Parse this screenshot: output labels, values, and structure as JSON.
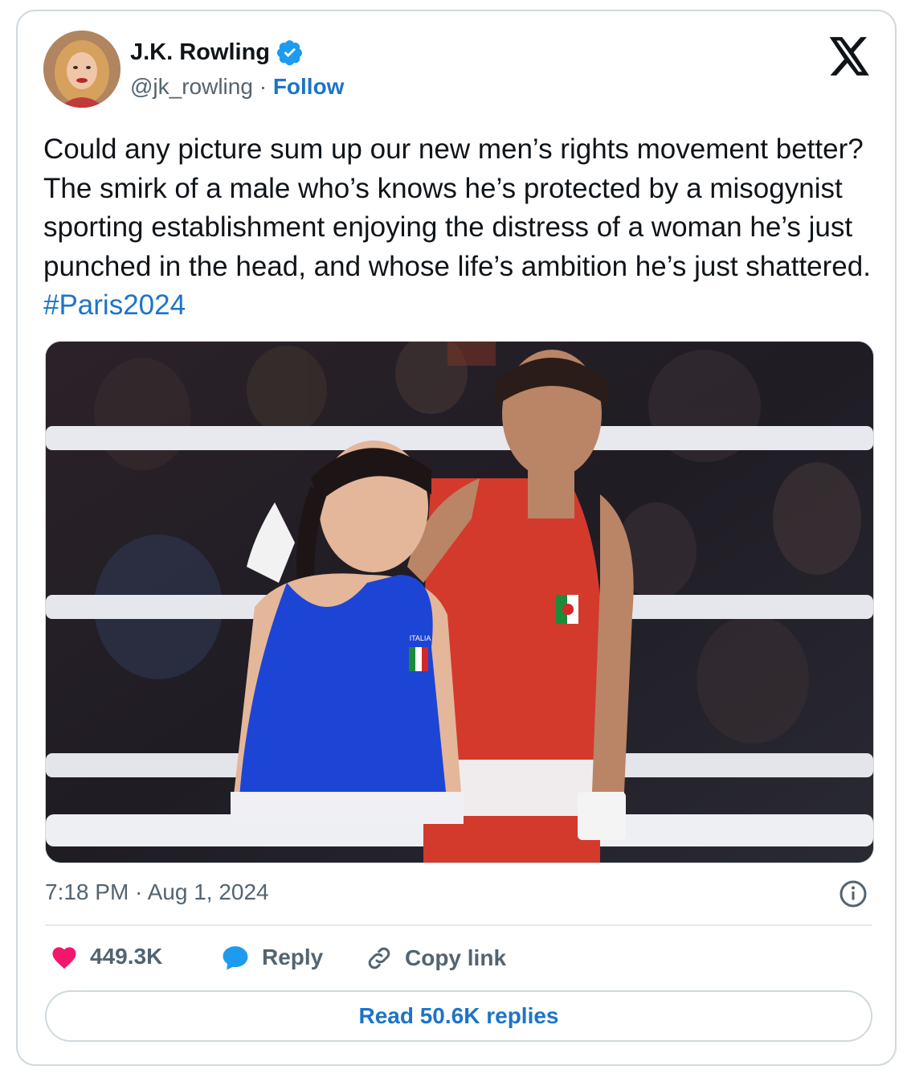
{
  "author": {
    "name": "J.K. Rowling",
    "handle": "@jk_rowling",
    "separator": "·",
    "follow_label": "Follow",
    "verified": true
  },
  "tweet": {
    "text": "Could any picture sum up our new men’s rights movement better? The smirk of a male who’s knows he’s protected by a misogynist sporting establishment enjoying the distress of a woman he’s just punched in the head, and whose life’s ambition he’s just shattered.",
    "hashtag": "#Paris2024"
  },
  "media": {
    "italy_flag_text": "ITALIA"
  },
  "meta": {
    "timestamp": "7:18 PM · Aug 1, 2024"
  },
  "actions": {
    "likes": "449.3K",
    "reply_label": "Reply",
    "copy_label": "Copy link"
  },
  "read_replies_label": "Read 50.6K replies",
  "colors": {
    "link": "#1d74c8",
    "heart": "#f3176b",
    "reply_icon": "#1d9bf0",
    "muted": "#536471",
    "border": "#cfd9de"
  },
  "icons": [
    "verified-badge-icon",
    "x-logo-icon",
    "info-icon",
    "heart-icon",
    "reply-bubble-icon",
    "link-icon"
  ]
}
